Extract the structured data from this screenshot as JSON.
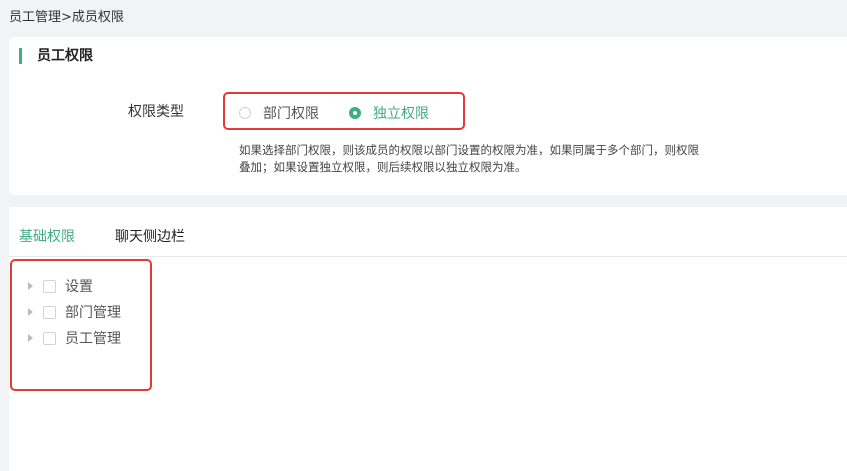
{
  "breadcrumb": {
    "text": "员工管理>成员权限"
  },
  "permissions_card": {
    "title": "员工权限",
    "type_label": "权限类型",
    "options": [
      {
        "label": "部门权限",
        "checked": false
      },
      {
        "label": "独立权限",
        "checked": true
      }
    ],
    "hint_lines": [
      "如果选择部门权限，则该成员的权限以部门设置的权限为准，如果同属于多个部门，则权限",
      "叠加；如果设置独立权限，则后续权限以独立权限为准。"
    ]
  },
  "tabs": [
    {
      "label": "基础权限",
      "active": true
    },
    {
      "label": "聊天侧边栏",
      "active": false
    }
  ],
  "tree": {
    "items": [
      {
        "label": "设置",
        "checked": false
      },
      {
        "label": "部门管理",
        "checked": false
      },
      {
        "label": "员工管理",
        "checked": false
      }
    ]
  },
  "colors": {
    "accent": "#3fae82",
    "highlight_border": "#e53935",
    "background": "#f2f3f5"
  }
}
